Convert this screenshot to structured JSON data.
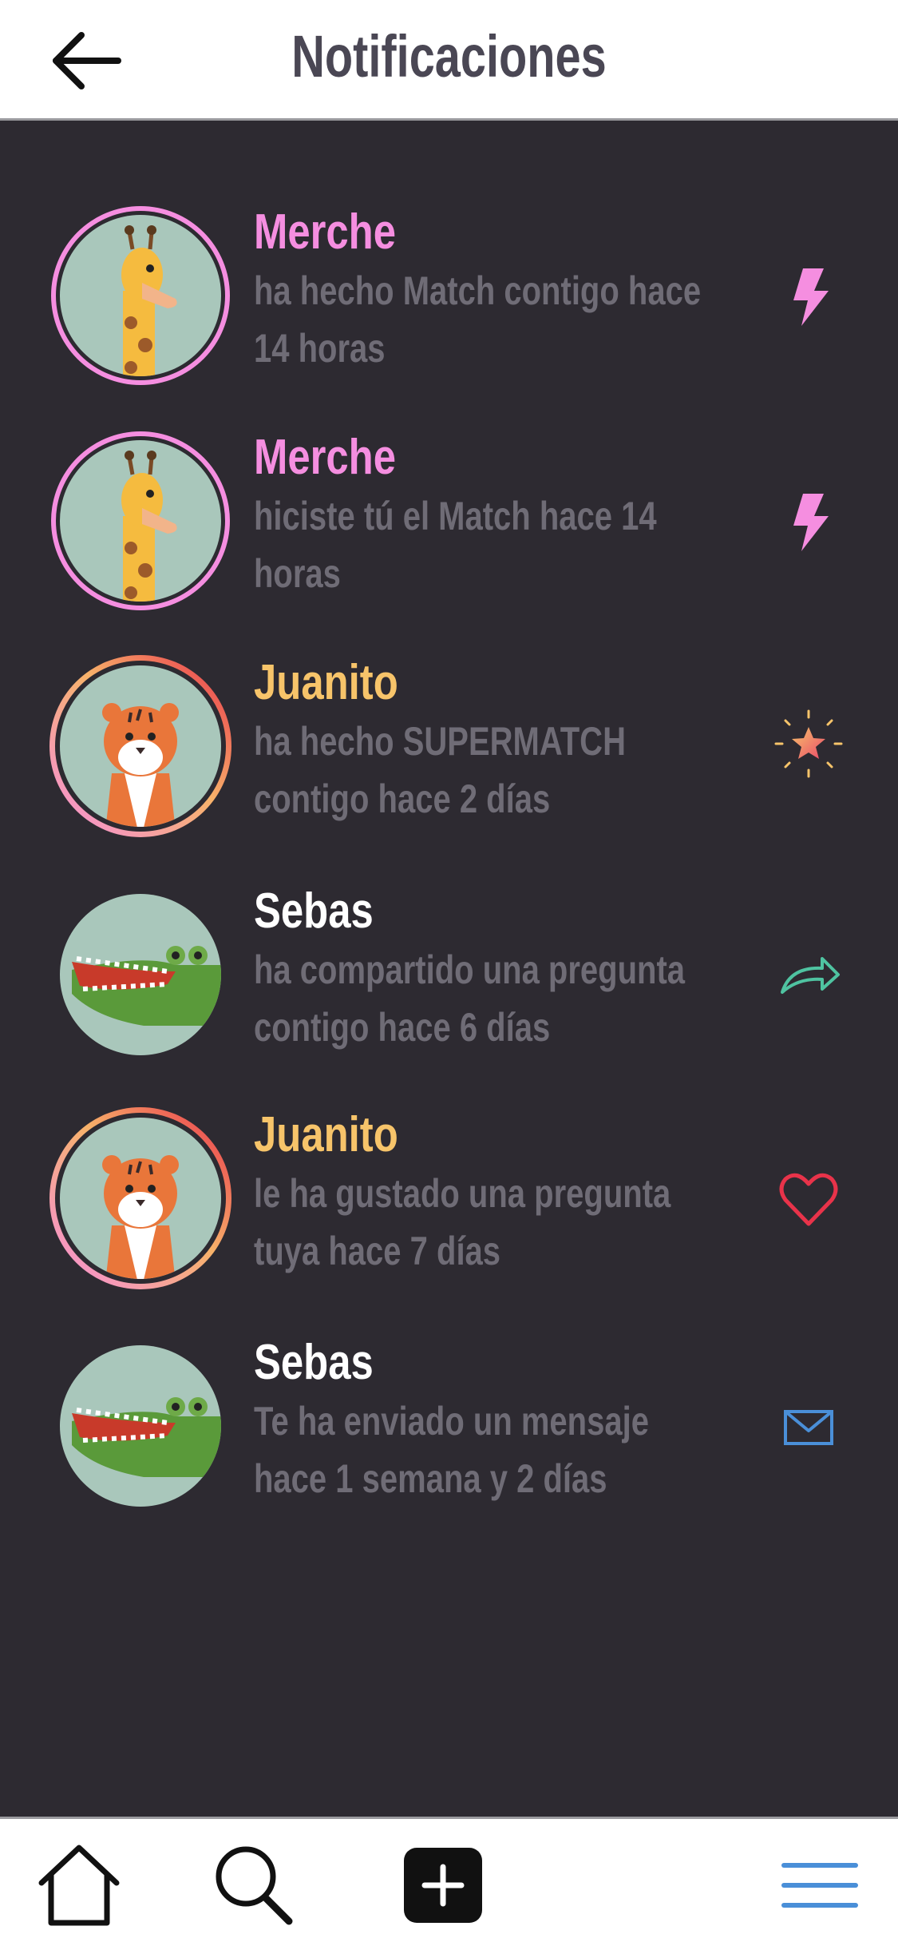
{
  "header": {
    "title": "Notificaciones",
    "back_icon": "arrow-left-icon"
  },
  "notifications": [
    {
      "name": "Merche",
      "message": "ha hecho Match contigo hace 14 horas",
      "avatar": "giraffe",
      "name_color": "#f58ee0",
      "ring": "pink",
      "action_icon": "lightning-icon",
      "action_color": "#f58ee0"
    },
    {
      "name": "Merche",
      "message": "hiciste tú el Match hace 14 horas",
      "avatar": "giraffe",
      "name_color": "#f58ee0",
      "ring": "pink",
      "action_icon": "lightning-icon",
      "action_color": "#f58ee0"
    },
    {
      "name": "Juanito",
      "message": "ha hecho SUPERMATCH contigo hace 2 días",
      "avatar": "tiger",
      "name_color": "#f7c46a",
      "ring": "gradient",
      "action_icon": "sparkle-star-icon",
      "action_color": "#f5a35a"
    },
    {
      "name": "Sebas",
      "message": "ha compartido una pregunta contigo hace 6 días",
      "avatar": "crocodile",
      "name_color": "#ffffff",
      "ring": "none",
      "action_icon": "share-arrow-icon",
      "action_color": "#4fc3a1"
    },
    {
      "name": "Juanito",
      "message": "le ha gustado una pregunta tuya hace 7 días",
      "avatar": "tiger",
      "name_color": "#f7c46a",
      "ring": "gradient",
      "action_icon": "heart-icon",
      "action_color": "#e8334a"
    },
    {
      "name": "Sebas",
      "message": "Te ha enviado un mensaje hace 1 semana y 2 días",
      "avatar": "crocodile",
      "name_color": "#ffffff",
      "ring": "none",
      "action_icon": "mail-icon",
      "action_color": "#4a8fd8"
    }
  ],
  "bottom_nav": {
    "items": [
      "home-icon",
      "search-icon",
      "add-icon",
      "menu-icon"
    ],
    "menu_color": "#4a8fd8"
  },
  "colors": {
    "background": "#2d2a31",
    "message_text": "#6f6c76",
    "header_title": "#4a4754"
  }
}
